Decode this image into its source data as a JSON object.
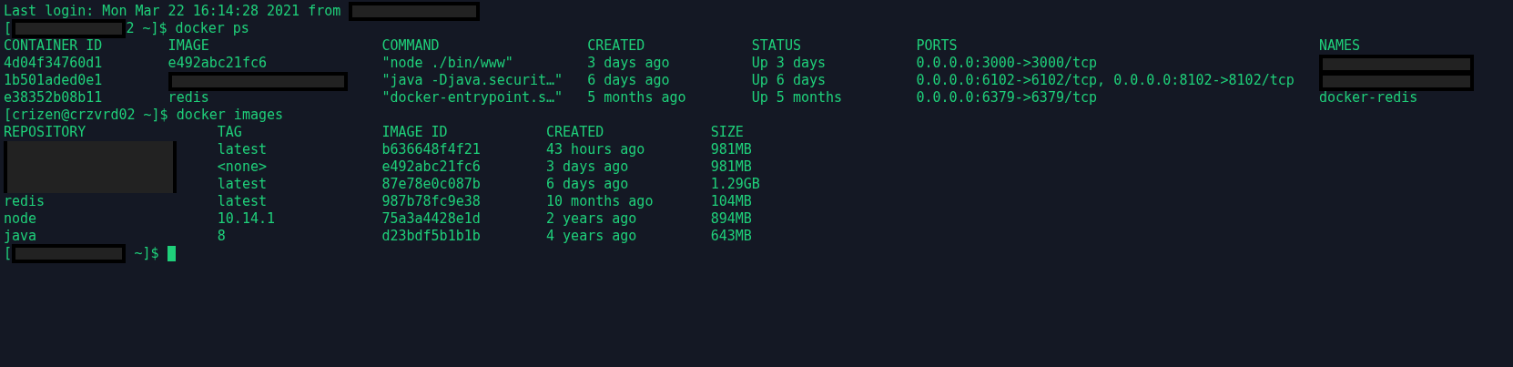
{
  "terminal": {
    "blocks": [
      {
        "kind": "line",
        "segments": [
          {
            "kind": "text",
            "text": "Last login: Mon Mar 22 16:14:28 2021 from "
          },
          {
            "kind": "redacted"
          }
        ]
      },
      {
        "kind": "line",
        "segments": [
          {
            "kind": "text",
            "text": "["
          },
          {
            "kind": "redacted"
          },
          {
            "kind": "text",
            "text": "2 ~]$ docker ps"
          }
        ]
      },
      {
        "kind": "table",
        "columns": [
          "CONTAINER ID",
          "IMAGE",
          "COMMAND",
          "CREATED",
          "STATUS",
          "PORTS",
          "NAMES"
        ],
        "rows": [
          [
            "4d04f34760d1",
            "e492abc21fc6",
            "\"node ./bin/www\"",
            "3 days ago",
            "Up 3 days",
            "0.0.0.0:3000->3000/tcp",
            {
              "redacted": true
            }
          ],
          [
            "1b501aded0e1",
            {
              "redacted": true
            },
            "\"java -Djava.securit…\"",
            "6 days ago",
            "Up 6 days",
            "0.0.0.0:6102->6102/tcp, 0.0.0.0:8102->8102/tcp",
            {
              "redacted": true
            }
          ],
          [
            "e38352b08b11",
            "redis",
            "\"docker-entrypoint.s…\"",
            "5 months ago",
            "Up 5 months",
            "0.0.0.0:6379->6379/tcp",
            "docker-redis"
          ]
        ]
      },
      {
        "kind": "line",
        "segments": [
          {
            "kind": "text",
            "text": "[crizen@crzvrd02 ~]$ docker images"
          }
        ]
      },
      {
        "kind": "table",
        "columns": [
          "REPOSITORY",
          "TAG",
          "IMAGE ID",
          "CREATED",
          "SIZE"
        ],
        "rows": [
          [
            {
              "redacted": true
            },
            "latest",
            "b636648f4f21",
            "43 hours ago",
            "981MB"
          ],
          [
            {
              "redacted": true
            },
            "<none>",
            "e492abc21fc6",
            "3 days ago",
            "981MB"
          ],
          [
            {
              "redacted": true
            },
            "latest",
            "87e78e0c087b",
            "6 days ago",
            "1.29GB"
          ],
          [
            "redis",
            "latest",
            "987b78fc9e38",
            "10 months ago",
            "104MB"
          ],
          [
            "node",
            "10.14.1",
            "75a3a4428e1d",
            "2 years ago",
            "894MB"
          ],
          [
            "java",
            "8",
            "d23bdf5b1b1b",
            "4 years ago",
            "643MB"
          ]
        ]
      },
      {
        "kind": "line",
        "cursor": true,
        "segments": [
          {
            "kind": "text",
            "text": "["
          },
          {
            "kind": "redacted"
          },
          {
            "kind": "text",
            "text": " ~]$ "
          }
        ]
      }
    ]
  }
}
